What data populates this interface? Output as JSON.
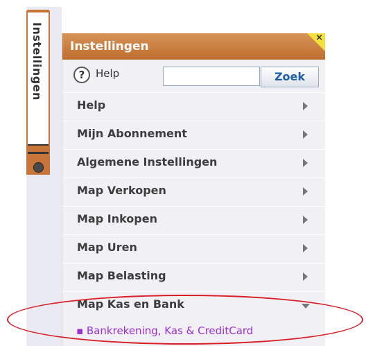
{
  "vertical_tab": {
    "label": "Instellingen"
  },
  "panel": {
    "title": "Instellingen",
    "close_label": "×",
    "help_label": "Help",
    "help_icon_glyph": "?",
    "search_value": "",
    "search_placeholder": "",
    "search_button": "Zoek"
  },
  "menu": [
    {
      "label": "Help"
    },
    {
      "label": "Mijn Abonnement"
    },
    {
      "label": "Algemene Instellingen"
    },
    {
      "label": "Map Verkopen"
    },
    {
      "label": "Map Inkopen"
    },
    {
      "label": "Map Uren"
    },
    {
      "label": "Map Belasting"
    },
    {
      "label": "Map Kas en Bank",
      "expanded": true
    }
  ],
  "submenu": {
    "item": "▪ Bankrekening, Kas & CreditCard"
  },
  "colors": {
    "header": "#c8753a",
    "close_corner": "#f4e03a",
    "submenu_text": "#9b2fd0",
    "highlight_ellipse": "#d81f26"
  }
}
